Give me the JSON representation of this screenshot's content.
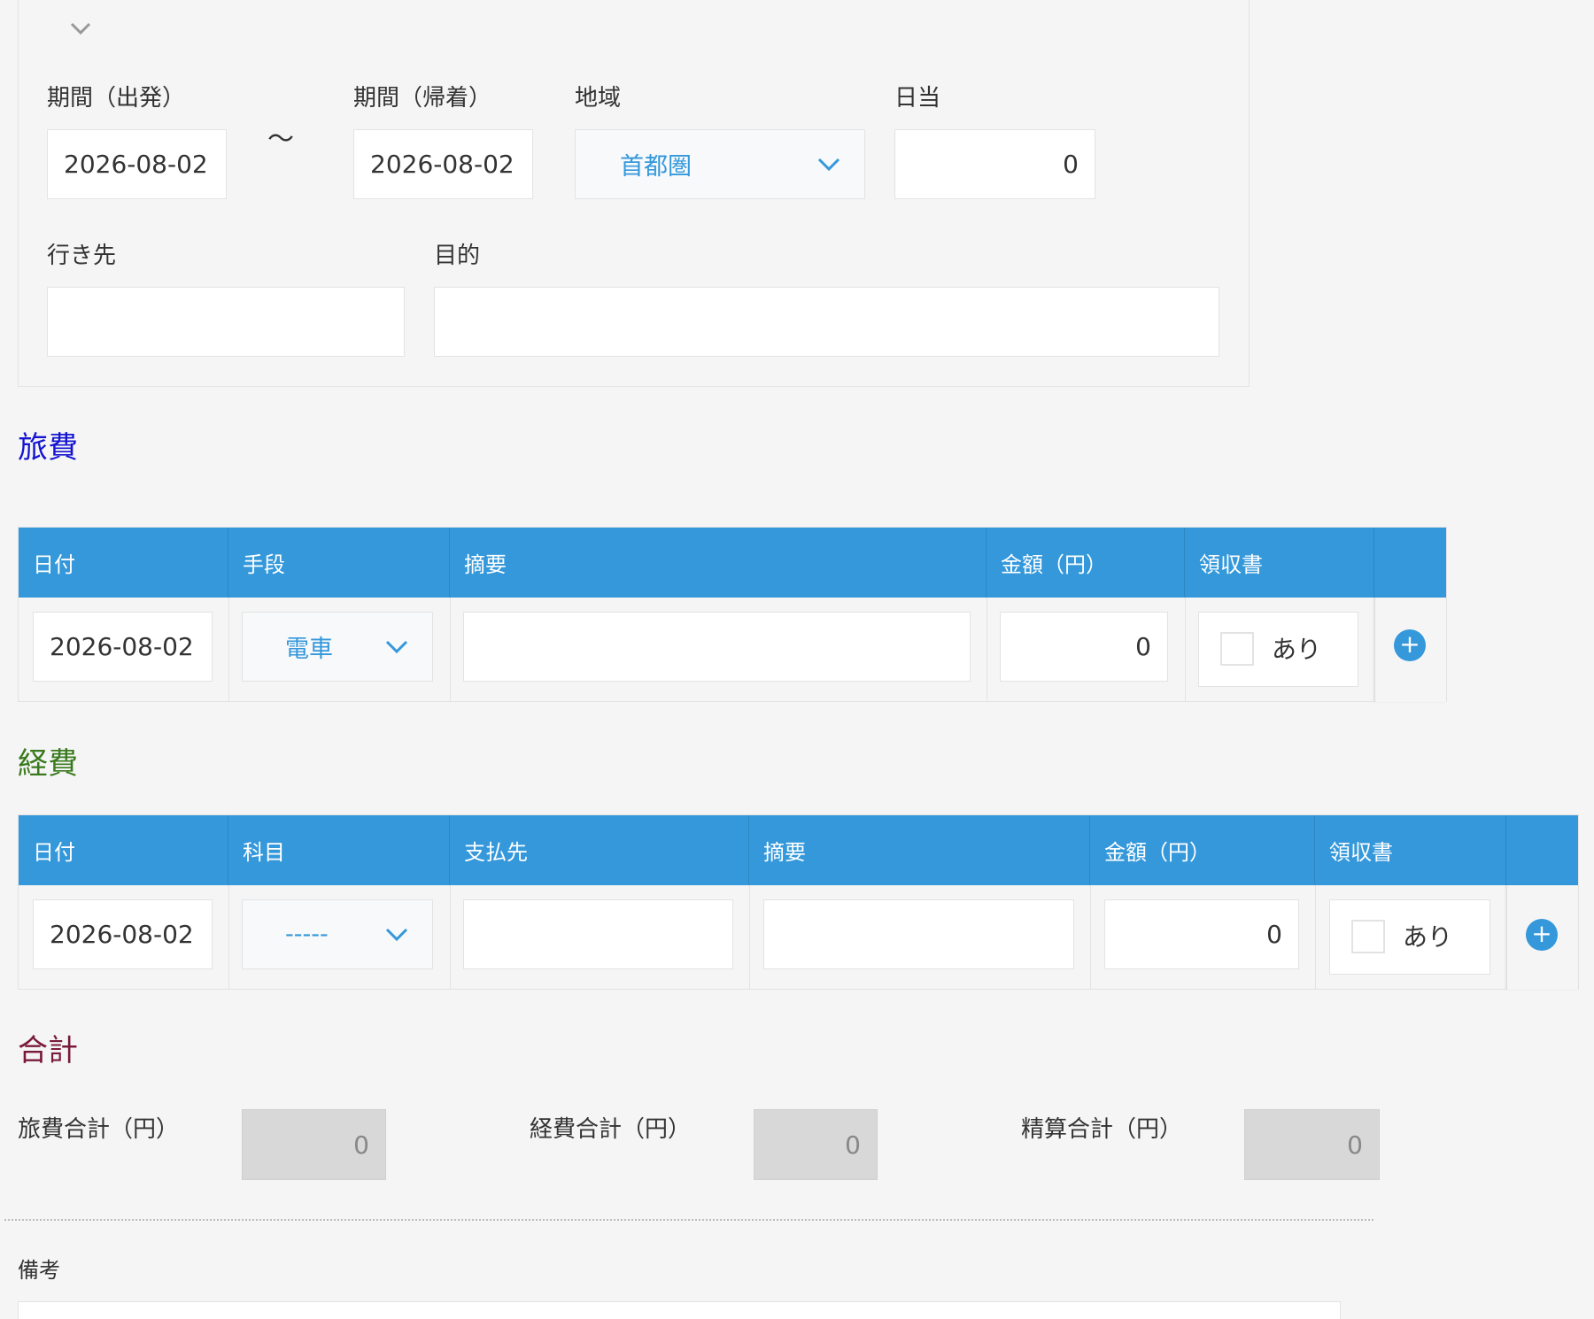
{
  "trip": {
    "depart_label": "期間（出発）",
    "depart_value": "2026-08-02",
    "tilde": "～",
    "return_label": "期間（帰着）",
    "return_value": "2026-08-02",
    "region_label": "地域",
    "region_value": "首都圏",
    "daily_label": "日当",
    "daily_value": "0",
    "destination_label": "行き先",
    "destination_value": "",
    "purpose_label": "目的",
    "purpose_value": ""
  },
  "travel": {
    "title": "旅費",
    "title_color": "#1414d2",
    "headers": [
      "日付",
      "手段",
      "摘要",
      "金額（円）",
      "領収書"
    ],
    "row": {
      "date": "2026-08-02",
      "method": "電車",
      "summary": "",
      "amount": "0",
      "receipt_label": "あり"
    }
  },
  "expense": {
    "title": "経費",
    "title_color": "#3a7a1e",
    "headers": [
      "日付",
      "科目",
      "支払先",
      "摘要",
      "金額（円）",
      "領収書"
    ],
    "row": {
      "date": "2026-08-02",
      "subject": "-----",
      "payee": "",
      "summary": "",
      "amount": "0",
      "receipt_label": "あり"
    }
  },
  "totals": {
    "title": "合計",
    "title_color": "#7a1a3a",
    "travel_label": "旅費合計（円）",
    "travel_value": "0",
    "expense_label": "経費合計（円）",
    "expense_value": "0",
    "settle_label": "精算合計（円）",
    "settle_value": "0"
  },
  "remarks": {
    "label": "備考",
    "value": ""
  },
  "icons": {
    "collapse": "chevron-down-icon",
    "dropdown": "chevron-down-icon",
    "add": "plus-circle-icon"
  },
  "colors": {
    "accent": "#3498db",
    "background": "#f5f5f5"
  }
}
